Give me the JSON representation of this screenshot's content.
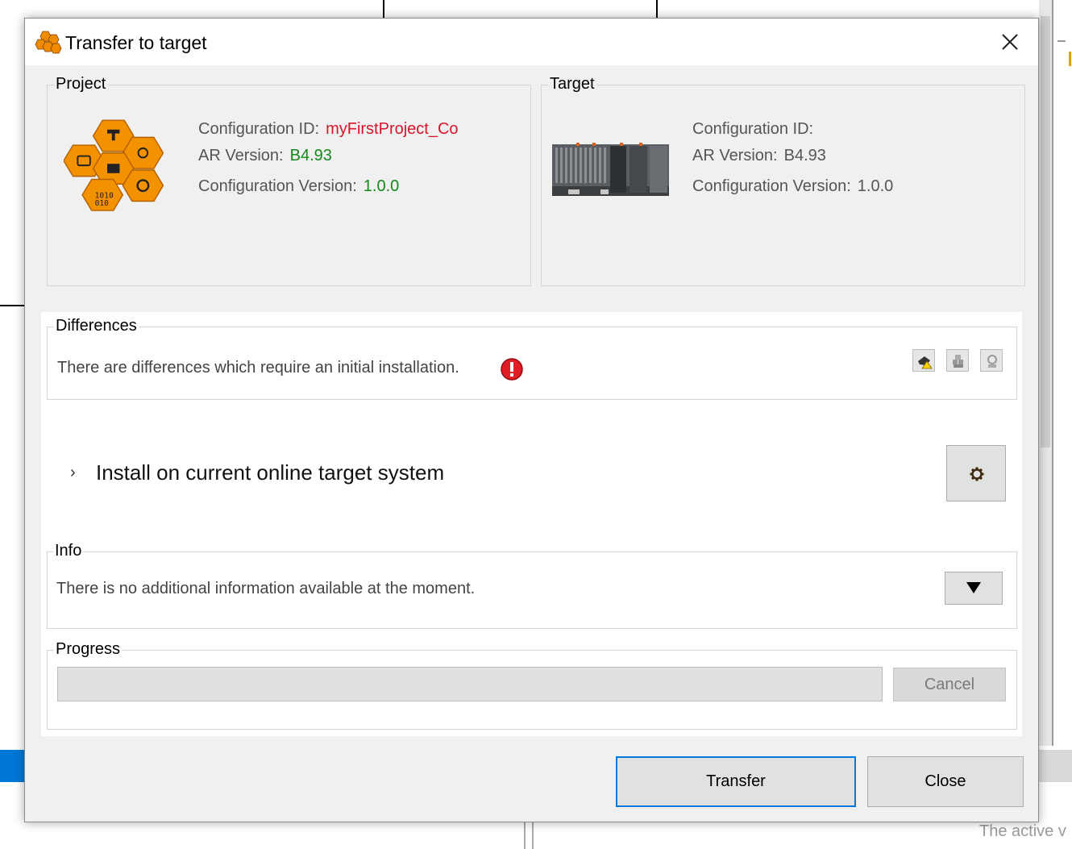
{
  "background": {
    "status_text": "The active v"
  },
  "dialog": {
    "title": "Transfer to target",
    "icons": {
      "app": "bnr-automation-hex-icon",
      "close": "close-icon"
    }
  },
  "project": {
    "label": "Project",
    "config_id_label": "Configuration ID:",
    "config_id_value": "myFirstProject_Co",
    "ar_version_label": "AR Version:",
    "ar_version_value": "B4.93",
    "config_version_label": "Configuration Version:",
    "config_version_value": "1.0.0"
  },
  "target": {
    "label": "Target",
    "config_id_label": "Configuration ID:",
    "config_id_value": "",
    "ar_version_label": "AR Version:",
    "ar_version_value": "B4.93",
    "config_version_label": "Configuration Version:",
    "config_version_value": "1.0.0"
  },
  "differences": {
    "label": "Differences",
    "message": "There are differences which require an initial installation."
  },
  "install": {
    "label": "Install on current online target system"
  },
  "info": {
    "label": "Info",
    "message": "There is no additional information available at the moment."
  },
  "progress": {
    "label": "Progress",
    "value": 0,
    "cancel_label": "Cancel"
  },
  "buttons": {
    "transfer_label": "Transfer",
    "close_label": "Close"
  },
  "colors": {
    "accent": "#0078d7",
    "error": "#d8142b",
    "ok": "#138a1a",
    "brand_orange": "#f08a00"
  }
}
